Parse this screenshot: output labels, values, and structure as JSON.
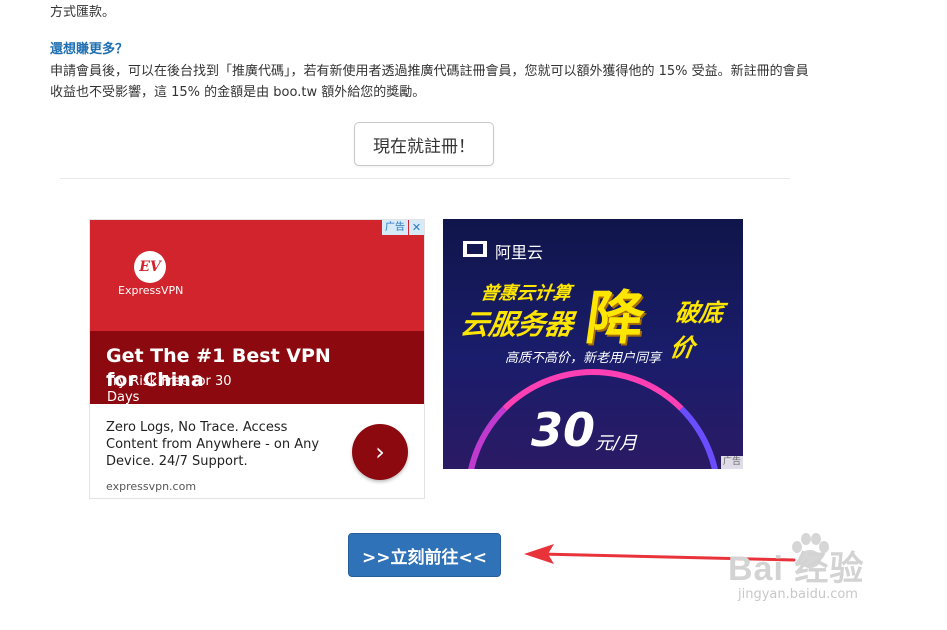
{
  "article": {
    "intro_tail": "方式匯款。",
    "heading": "還想賺更多？",
    "paragraph": "申請會員後，可以在後台找到「推廣代碼」，若有新使用者透過推廣代碼註冊會員，您就可以額外獲得他的 15% 受益。新註冊的會員收益也不受影響，這 15% 的金額是由 boo.tw 額外給您的獎勵。",
    "register_button": "現在就註冊！",
    "go_button": ">>立刻前往<<"
  },
  "ad_expressvpn": {
    "logo_mark": "EV",
    "logo_text": "ExpressVPN",
    "headline": "Get The #1 Best VPN for China",
    "subline": "Try Risk Free for 30 Days",
    "body": "Zero Logs, No Trace. Access Content from Anywhere - on Any Device. 24/7 Support.",
    "domain": "expressvpn.com",
    "ad_badge": "广告",
    "close_glyph": "✕",
    "cta_glyph": "›"
  },
  "ad_aliyun": {
    "logo_text": "阿里云",
    "line1": "普惠云计算",
    "line2": "云服务器",
    "big": "降",
    "line3": "破底价",
    "tagline": "高质不高价，新老用户同享",
    "price": "30",
    "unit": "元/月",
    "ad_badge": "广告"
  },
  "watermark": {
    "main": "Bai  经验",
    "sub": "jingyan.baidu.com"
  },
  "colors": {
    "heading": "#1f6fb2",
    "go_button": "#2f72b8",
    "arrow": "#e8333a",
    "vpn_red": "#d1242c",
    "vpn_dark": "#8c0a0f"
  }
}
